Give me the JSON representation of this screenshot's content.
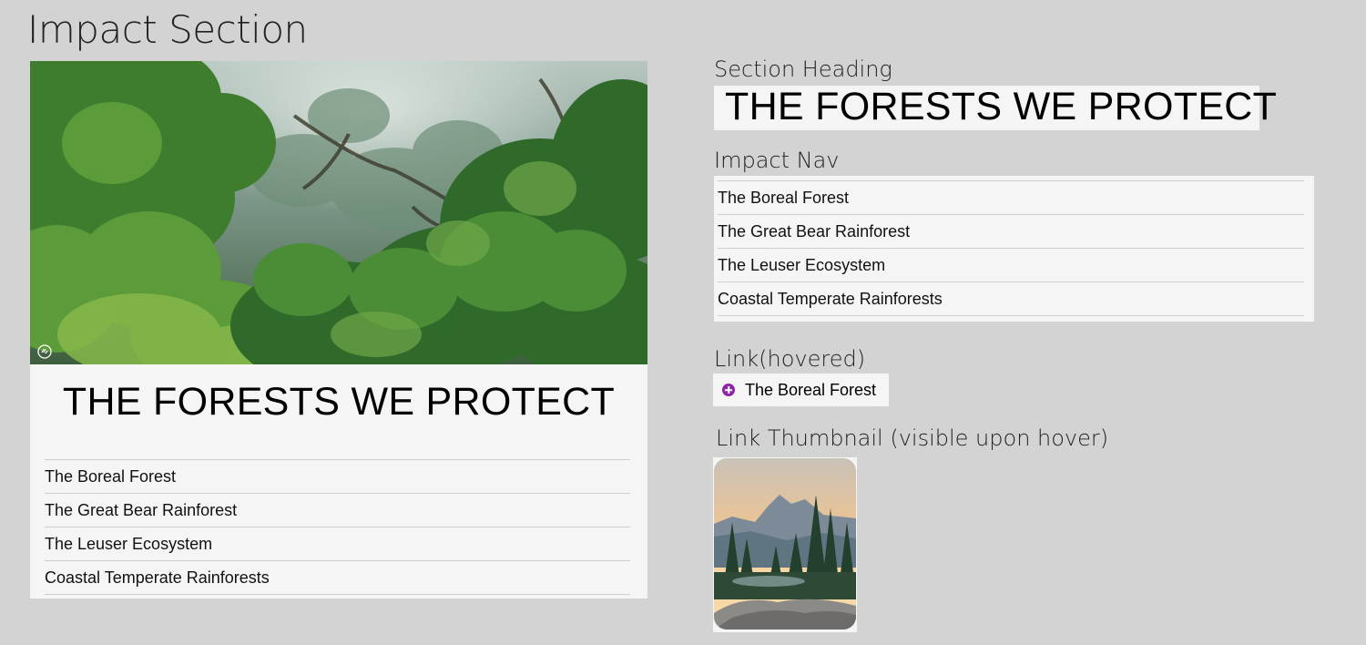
{
  "page": {
    "title": "Impact Section"
  },
  "card": {
    "heading": "THE FORESTS WE PROTECT",
    "nav_items": [
      "The Boreal Forest",
      "The Great Bear Rainforest",
      "The Leuser Ecosystem",
      "Coastal Temperate Rainforests"
    ]
  },
  "specs": {
    "section_heading_label": "Section Heading",
    "section_heading_text": "THE FORESTS WE PROTECT",
    "impact_nav_label": "Impact Nav",
    "impact_nav_items": [
      "The Boreal Forest",
      "The Great Bear Rainforest",
      "The Leuser Ecosystem",
      "Coastal Temperate Rainforests"
    ],
    "link_hovered_label": "Link(hovered)",
    "link_hovered_text": "The Boreal Forest",
    "link_thumbnail_label": "Link Thumbnail (visible upon hover)"
  },
  "colors": {
    "background": "#d3d3d3",
    "panel": "#f5f5f5",
    "hover_accent": "#8e24aa",
    "divider": "#cfcfcf"
  },
  "icons": {
    "hover_marker": "plus-circle-icon",
    "image_badge": "hand-icon"
  }
}
